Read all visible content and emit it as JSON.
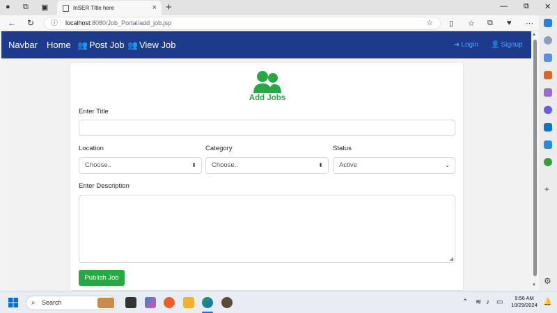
{
  "browser": {
    "tab_title": "InSER TItle here",
    "url_host": "localhost",
    "url_path": ":8080/Job_Portal/add_job.jsp"
  },
  "navbar": {
    "brand": "Navbar",
    "home": "Home",
    "post_job": "Post Job",
    "view_job": "View Job",
    "login": "Login",
    "signup": "Signup",
    "bg_color": "#1e3a8a"
  },
  "form": {
    "heading": "Add Jobs",
    "title_label": "Enter Title",
    "title_value": "",
    "location_label": "Location",
    "location_value": "Choose..",
    "category_label": "Category",
    "category_value": "Choose..",
    "status_label": "Status",
    "status_value": "Active",
    "description_label": "Enter Description",
    "description_value": "",
    "submit_label": "Publish Job",
    "accent_color": "#28a745"
  },
  "taskbar": {
    "search_placeholder": "Search",
    "time": "9:56 AM",
    "date": "10/29/2024"
  }
}
